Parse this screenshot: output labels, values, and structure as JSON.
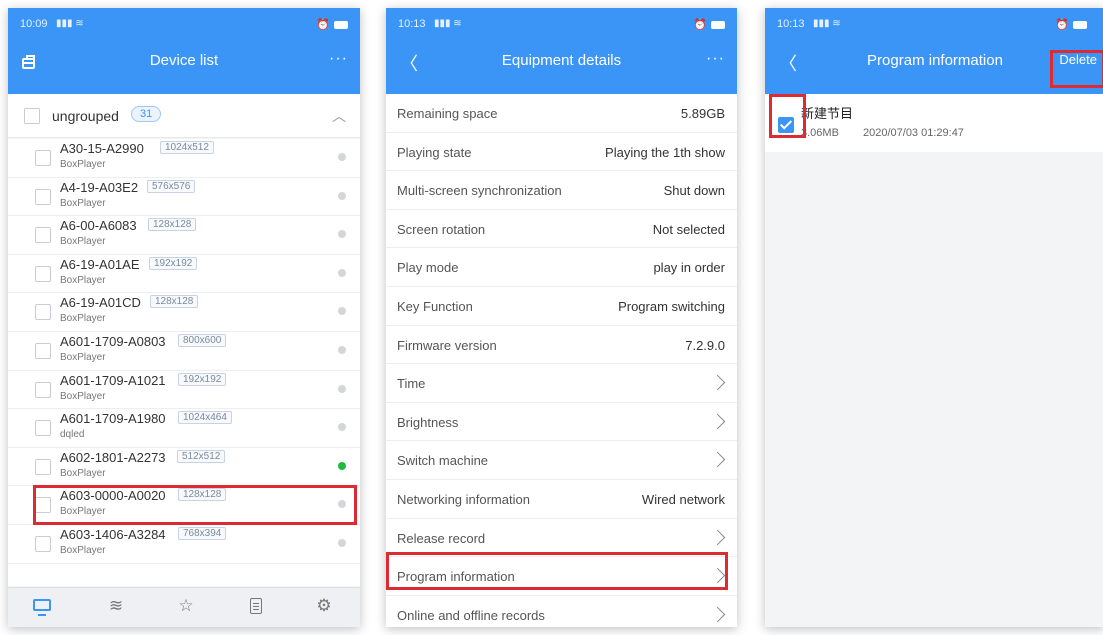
{
  "colors": {
    "header": "#3b95f6",
    "highlight": "#dd2b33",
    "online": "#1dbb3c",
    "offline": "#d4d6da"
  },
  "device_list_screen": {
    "status": {
      "time": "10:09",
      "signal": "4G",
      "right_icons": "alarm-icon battery-icon"
    },
    "title": "Device list",
    "left_icon": "briefcase-icon",
    "more": "···",
    "group": {
      "name": "ungrouped",
      "count": "31"
    },
    "devices": [
      {
        "name": "A30-15-A2990",
        "resolution": "1024x512",
        "type": "BoxPlayer",
        "online": false
      },
      {
        "name": "A4-19-A03E2",
        "resolution": "576x576",
        "type": "BoxPlayer",
        "online": false
      },
      {
        "name": "A6-00-A6083",
        "resolution": "128x128",
        "type": "BoxPlayer",
        "online": false
      },
      {
        "name": "A6-19-A01AE",
        "resolution": "192x192",
        "type": "BoxPlayer",
        "online": false
      },
      {
        "name": "A6-19-A01CD",
        "resolution": "128x128",
        "type": "BoxPlayer",
        "online": false
      },
      {
        "name": "A601-1709-A0803",
        "resolution": "800x600",
        "type": "BoxPlayer",
        "online": false
      },
      {
        "name": "A601-1709-A1021",
        "resolution": "192x192",
        "type": "BoxPlayer",
        "online": false
      },
      {
        "name": "A601-1709-A1980",
        "resolution": "1024x464",
        "type": "dqled",
        "online": false
      },
      {
        "name": "A602-1801-A2273",
        "resolution": "512x512",
        "type": "BoxPlayer",
        "online": true
      },
      {
        "name": "A603-0000-A0020",
        "resolution": "128x128",
        "type": "BoxPlayer",
        "online": false
      },
      {
        "name": "A603-1406-A3284",
        "resolution": "768x394",
        "type": "BoxPlayer",
        "online": false
      }
    ],
    "tabs": [
      "monitor-icon",
      "layers-icon",
      "star-icon",
      "list-icon",
      "settings-icon"
    ]
  },
  "equipment_details_screen": {
    "status": {
      "time": "10:13",
      "signal": "4G"
    },
    "title": "Equipment details",
    "more": "···",
    "rows": [
      {
        "label": "Remaining space",
        "value": "5.89GB"
      },
      {
        "label": "Playing state",
        "value": "Playing the 1th show"
      },
      {
        "label": "Multi-screen synchronization",
        "value": "Shut down"
      },
      {
        "label": "Screen rotation",
        "value": "Not selected"
      },
      {
        "label": "Play mode",
        "value": "play in order"
      },
      {
        "label": "Key Function",
        "value": "Program switching"
      },
      {
        "label": "Firmware version",
        "value": "7.2.9.0"
      },
      {
        "label": "Time",
        "value": ""
      },
      {
        "label": "Brightness",
        "value": ""
      },
      {
        "label": "Switch machine",
        "value": ""
      },
      {
        "label": "Networking information",
        "value": "Wired network"
      },
      {
        "label": "Release record",
        "value": ""
      },
      {
        "label": "Program information",
        "value": ""
      },
      {
        "label": "Online and offline records",
        "value": ""
      }
    ]
  },
  "program_information_screen": {
    "status": {
      "time": "10:13",
      "signal": "4G"
    },
    "title": "Program information",
    "delete_label": "Delete",
    "program": {
      "name": "新建节目",
      "size": "3.06MB",
      "date": "2020/07/03 01:29:47",
      "checked": true
    }
  }
}
